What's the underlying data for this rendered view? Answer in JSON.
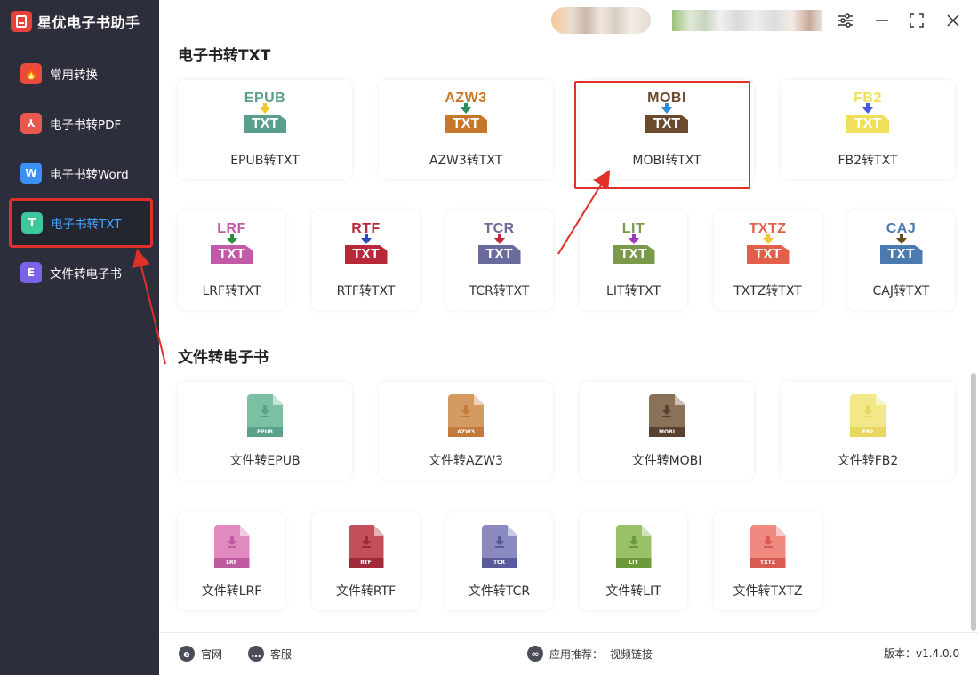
{
  "app": {
    "name": "星优电子书助手"
  },
  "sidebar": {
    "items": [
      {
        "label": "常用转换",
        "icon": "flame-icon",
        "color": "#ea4b3a",
        "glyph": "🔥"
      },
      {
        "label": "电子书转PDF",
        "icon": "pdf-icon",
        "color": "#e8584f",
        "glyph": "⅄"
      },
      {
        "label": "电子书转Word",
        "icon": "word-icon",
        "color": "#3b8ff5",
        "glyph": "W"
      },
      {
        "label": "电子书转TXT",
        "icon": "txt-icon",
        "color": "#3cc89a",
        "glyph": "T",
        "active": true
      },
      {
        "label": "文件转电子书",
        "icon": "ebook-icon",
        "color": "#7a63e8",
        "glyph": "E"
      }
    ]
  },
  "sections": {
    "ebook_to_txt": {
      "title": "电子书转TXT",
      "cards": [
        {
          "label": "EPUB转TXT",
          "format": "EPUB",
          "color": "#5a9f8e",
          "arrow": "#f2c731"
        },
        {
          "label": "AZW3转TXT",
          "format": "AZW3",
          "color": "#c6782a",
          "arrow": "#2a8f5a"
        },
        {
          "label": "MOBI转TXT",
          "format": "MOBI",
          "color": "#6a4a2c",
          "arrow": "#2a8fd8"
        },
        {
          "label": "FB2转TXT",
          "format": "FB2",
          "color": "#f0df5a",
          "arrow": "#4a5ad8"
        },
        {
          "label": "LRF转TXT",
          "format": "LRF",
          "color": "#c25aa8",
          "arrow": "#2a8f3a"
        },
        {
          "label": "RTF转TXT",
          "format": "RTF",
          "color": "#b8283a",
          "arrow": "#2a4ab8"
        },
        {
          "label": "TCR转TXT",
          "format": "TCR",
          "color": "#6a6a9c",
          "arrow": "#c22a3a"
        },
        {
          "label": "LIT转TXT",
          "format": "LIT",
          "color": "#7a9a4a",
          "arrow": "#9a3ab8"
        },
        {
          "label": "TXTZ转TXT",
          "format": "TXTZ",
          "color": "#e2604a",
          "arrow": "#f2c731"
        },
        {
          "label": "CAJ转TXT",
          "format": "CAJ",
          "color": "#4a7ab0",
          "arrow": "#6a4a1a"
        }
      ]
    },
    "file_to_ebook": {
      "title": "文件转电子书",
      "cards": [
        {
          "label": "文件转EPUB",
          "format": "EPUB",
          "color": "#7cc0a4",
          "band": "#5aa08a"
        },
        {
          "label": "文件转AZW3",
          "format": "AZW3",
          "color": "#d49a62",
          "band": "#c47a3a"
        },
        {
          "label": "文件转MOBI",
          "format": "MOBI",
          "color": "#8a7258",
          "band": "#5a4030"
        },
        {
          "label": "文件转FB2",
          "format": "FB2",
          "color": "#f2e88a",
          "band": "#e8d860"
        },
        {
          "label": "文件转LRF",
          "format": "LRF",
          "color": "#e08ac0",
          "band": "#c05aa0"
        },
        {
          "label": "文件转RTF",
          "format": "RTF",
          "color": "#c2505a",
          "band": "#a02a3a"
        },
        {
          "label": "文件转TCR",
          "format": "TCR",
          "color": "#8a8ac0",
          "band": "#5a5a9a"
        },
        {
          "label": "文件转LIT",
          "format": "LIT",
          "color": "#9ac06a",
          "band": "#6a9a3a"
        },
        {
          "label": "文件转TXTZ",
          "format": "TXTZ",
          "color": "#f08a80",
          "band": "#d85a50"
        }
      ]
    }
  },
  "footer": {
    "website": "官网",
    "support": "客服",
    "recommend_label": "应用推荐：",
    "recommend_link": "视频链接",
    "version": "版本：v1.4.0.0"
  },
  "colors": {
    "sidebar_bg": "#2c2e3b",
    "highlight": "#e0302a",
    "active_text": "#4aa3ff"
  }
}
